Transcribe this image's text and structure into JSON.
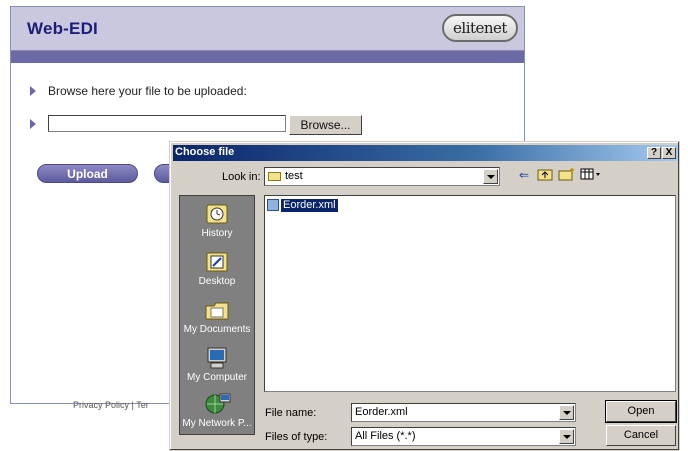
{
  "page": {
    "title": "Web-EDI",
    "logo_text": "elitenet",
    "browse_label": "Browse here your file to be uploaded:",
    "file_path_value": "",
    "browse_button": "Browse...",
    "upload_button": "Upload",
    "second_button": "",
    "footer": "Privacy Policy | Ter",
    "colors": {
      "header": "#c9c8de",
      "stripe": "#6c6aa6",
      "title": "#1e1e78"
    }
  },
  "dialog": {
    "title": "Choose file",
    "help_button": "?",
    "close_button": "X",
    "look_in_label": "Look in:",
    "look_in_value": "test",
    "toolbar_icons": [
      "back-arrow-icon",
      "up-folder-icon",
      "new-folder-icon",
      "view-menu-icon"
    ],
    "places": [
      {
        "label": "History",
        "icon": "history-icon"
      },
      {
        "label": "Desktop",
        "icon": "desktop-icon"
      },
      {
        "label": "My Documents",
        "icon": "my-documents-icon"
      },
      {
        "label": "My Computer",
        "icon": "my-computer-icon"
      },
      {
        "label": "My Network P...",
        "icon": "my-network-icon"
      }
    ],
    "files": [
      {
        "name": "Eorder.xml",
        "selected": true
      }
    ],
    "file_name_label": "File name:",
    "file_name_value": "Eorder.xml",
    "file_type_label": "Files of type:",
    "file_type_value": "All Files (*.*)",
    "open_button": "Open",
    "cancel_button": "Cancel"
  }
}
